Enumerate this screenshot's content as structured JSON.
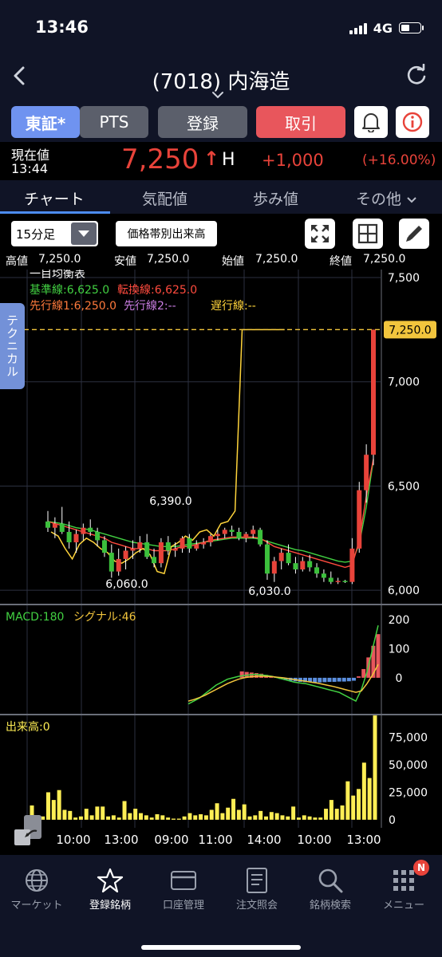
{
  "status": {
    "time": "13:46",
    "network": "4G"
  },
  "nav": {
    "title": "(7018) 内海造"
  },
  "buttons": {
    "market": "東証*",
    "pts": "PTS",
    "register": "登録",
    "trade": "取引"
  },
  "price": {
    "label": "現在値",
    "time": "13:44",
    "value": "7,250",
    "arrow": "↑",
    "flag": "H",
    "change": "+1,000",
    "change_pct": "(+16.00%)"
  },
  "tabs": [
    "チャート",
    "気配値",
    "歩み値",
    "その他"
  ],
  "toolbar": {
    "interval": "15分足",
    "volume_profile": "価格帯別出来高"
  },
  "ohlc": {
    "high_label": "高値",
    "high": "7,250.0",
    "low_label": "安値",
    "low": "7,250.0",
    "open_label": "始値",
    "open": "7,250.0",
    "close_label": "終値",
    "close": "7,250.0"
  },
  "side_tab": "テクニカル",
  "bottom_nav": [
    "マーケット",
    "登録銘柄",
    "口座管理",
    "注文照会",
    "銘柄検索",
    "メニュー"
  ],
  "bottom_badge": "N",
  "colors": {
    "up": "#e8433a",
    "down": "#3cc03c",
    "accent": "#4c8cf0",
    "button_blue": "#6f93f0",
    "button_red": "#e8565c",
    "button_gray": "#5b5f6b",
    "background": "#101426"
  },
  "chart_data": [
    {
      "type": "candlestick",
      "title": "一目均衡表",
      "legend": {
        "kijun": "基準線:6,625.0",
        "tenkan": "転換線:6,625.0",
        "senko1": "先行線1:6,250.0",
        "senko2": "先行線2:--",
        "chikou": "遅行線:--"
      },
      "ylim": [
        5970,
        7500
      ],
      "y_ticks": [
        "7,500",
        "7,000",
        "6,500",
        "6,000"
      ],
      "y_tick_values": [
        7500,
        7000,
        6500,
        6000
      ],
      "x_ticks": [
        "10:00",
        "13:00",
        "09:00",
        "11:00",
        "14:00",
        "10:00",
        "13:00"
      ],
      "last_price_label": "7,250.0",
      "last_price": 7250,
      "annotations": [
        {
          "text": "6,390.0",
          "value": 6390
        },
        {
          "text": "6,060.0",
          "value": 6060
        },
        {
          "text": "6,030.0",
          "value": 6030
        }
      ],
      "candles": [
        [
          6330,
          6380,
          6280,
          6300
        ],
        [
          6300,
          6350,
          6250,
          6320
        ],
        [
          6320,
          6400,
          6270,
          6280
        ],
        [
          6280,
          6330,
          6200,
          6230
        ],
        [
          6230,
          6290,
          6180,
          6270
        ],
        [
          6270,
          6320,
          6240,
          6300
        ],
        [
          6300,
          6340,
          6260,
          6280
        ],
        [
          6280,
          6300,
          6210,
          6240
        ],
        [
          6240,
          6260,
          6160,
          6180
        ],
        [
          6180,
          6220,
          6060,
          6090
        ],
        [
          6090,
          6200,
          6070,
          6150
        ],
        [
          6150,
          6210,
          6100,
          6190
        ],
        [
          6190,
          6240,
          6150,
          6200
        ],
        [
          6200,
          6260,
          6180,
          6230
        ],
        [
          6230,
          6270,
          6150,
          6160
        ],
        [
          6160,
          6200,
          6110,
          6130
        ],
        [
          6130,
          6250,
          6110,
          6230
        ],
        [
          6230,
          6260,
          6170,
          6190
        ],
        [
          6190,
          6230,
          6160,
          6200
        ],
        [
          6200,
          6260,
          6180,
          6250
        ],
        [
          6250,
          6270,
          6180,
          6200
        ],
        [
          6200,
          6240,
          6190,
          6220
        ],
        [
          6220,
          6250,
          6200,
          6230
        ],
        [
          6230,
          6270,
          6210,
          6260
        ],
        [
          6260,
          6290,
          6240,
          6270
        ],
        [
          6270,
          6300,
          6250,
          6290
        ],
        [
          6290,
          6310,
          6260,
          6280
        ],
        [
          6280,
          6300,
          6240,
          6250
        ],
        [
          6250,
          6280,
          6230,
          6270
        ],
        [
          6270,
          6310,
          6250,
          6290
        ],
        [
          6290,
          6300,
          6210,
          6220
        ],
        [
          6220,
          6240,
          6050,
          6080
        ],
        [
          6080,
          6160,
          6040,
          6140
        ],
        [
          6140,
          6200,
          6100,
          6180
        ],
        [
          6180,
          6220,
          6120,
          6130
        ],
        [
          6130,
          6160,
          6080,
          6100
        ],
        [
          6100,
          6160,
          6090,
          6140
        ],
        [
          6140,
          6170,
          6090,
          6110
        ],
        [
          6110,
          6130,
          6060,
          6080
        ],
        [
          6080,
          6100,
          6040,
          6060
        ],
        [
          6060,
          6090,
          6030,
          6040
        ],
        [
          6040,
          6060,
          6030,
          6045
        ],
        [
          6045,
          6050,
          6035,
          6040
        ],
        [
          6040,
          6250,
          6030,
          6200
        ],
        [
          6200,
          6520,
          6180,
          6480
        ],
        [
          6480,
          6700,
          6420,
          6650
        ],
        [
          6650,
          7250,
          6600,
          7250
        ]
      ],
      "tenkan": [
        6330,
        6320,
        6310,
        6300,
        6290,
        6280,
        6270,
        6260,
        6250,
        6230,
        6220,
        6210,
        6200,
        6200,
        6200,
        6190,
        6190,
        6190,
        6200,
        6210,
        6210,
        6220,
        6230,
        6240,
        6245,
        6250,
        6255,
        6255,
        6255,
        6255,
        6250,
        6230,
        6210,
        6200,
        6190,
        6180,
        6170,
        6160,
        6150,
        6140,
        6130,
        6120,
        6110,
        6120,
        6240,
        6450,
        6630
      ],
      "kijun": [
        6330,
        6325,
        6320,
        6310,
        6300,
        6295,
        6290,
        6280,
        6270,
        6260,
        6250,
        6240,
        6230,
        6225,
        6220,
        6215,
        6210,
        6210,
        6210,
        6215,
        6220,
        6225,
        6230,
        6235,
        6240,
        6245,
        6250,
        6250,
        6250,
        6250,
        6245,
        6235,
        6225,
        6215,
        6205,
        6195,
        6190,
        6180,
        6170,
        6160,
        6150,
        6140,
        6135,
        6140,
        6220,
        6400,
        6625
      ],
      "chikou": [
        6280,
        6260,
        6200,
        6150,
        6220,
        6250,
        6230,
        6200,
        6180,
        6140,
        6130,
        6150,
        6180,
        6200,
        6170,
        6090,
        6080,
        6210,
        6230,
        6260,
        6240,
        6280,
        6290,
        6260,
        6320,
        6330,
        6380,
        7250,
        7250,
        7250,
        7250,
        7250,
        7250,
        7250
      ]
    },
    {
      "type": "line",
      "title": "MACD:180",
      "signal_label": "シグナル:46",
      "y_ticks": [
        "200",
        "100",
        "0"
      ],
      "y_tick_values": [
        200,
        100,
        0
      ],
      "ylim": [
        -110,
        230
      ],
      "macd": [
        -90,
        -80,
        -70,
        -55,
        -40,
        -25,
        -15,
        -5,
        0,
        5,
        8,
        10,
        12,
        10,
        8,
        5,
        0,
        -5,
        -10,
        -15,
        -18,
        -20,
        -25,
        -30,
        -35,
        -40,
        -45,
        -50,
        -60,
        -70,
        -80,
        -40,
        20,
        100,
        180
      ],
      "signal": [
        -80,
        -75,
        -68,
        -60,
        -50,
        -40,
        -30,
        -20,
        -12,
        -5,
        0,
        3,
        5,
        6,
        5,
        4,
        2,
        0,
        -3,
        -6,
        -9,
        -12,
        -15,
        -18,
        -22,
        -26,
        -30,
        -35,
        -40,
        -45,
        -50,
        -45,
        -20,
        10,
        46
      ],
      "hist": [
        0,
        0,
        0,
        0,
        0,
        0,
        0,
        0,
        0,
        0,
        0,
        22,
        20,
        18,
        16,
        14,
        10,
        6,
        2,
        -4,
        -8,
        -10,
        -12,
        -14,
        -15,
        -15,
        -16,
        -16,
        -15,
        -14,
        -14,
        -13,
        -13,
        -12,
        -10,
        5,
        30,
        70,
        110,
        150
      ]
    },
    {
      "type": "bar",
      "title": "出来高:0",
      "y_ticks": [
        "75,000",
        "50,000",
        "25,000",
        "0"
      ],
      "y_tick_values": [
        75000,
        50000,
        25000,
        0
      ],
      "ylim": [
        -3000,
        90000
      ],
      "values": [
        13000,
        4000,
        3000,
        25000,
        18000,
        27000,
        9000,
        8000,
        2000,
        3000,
        10000,
        4000,
        12000,
        12000,
        3000,
        4000,
        2000,
        17000,
        6000,
        10000,
        6000,
        4000,
        2000,
        5000,
        4000,
        2000,
        1000,
        1000,
        3000,
        6000,
        4000,
        5000,
        4000,
        9000,
        15000,
        6000,
        11000,
        19000,
        9000,
        14000,
        3000,
        4000,
        8000,
        3000,
        7000,
        6000,
        4000,
        3000,
        12000,
        2000,
        4000,
        3000,
        2000,
        2000,
        10000,
        18000,
        10000,
        13000,
        35000,
        22000,
        28000,
        52000,
        38000,
        95000
      ]
    }
  ]
}
